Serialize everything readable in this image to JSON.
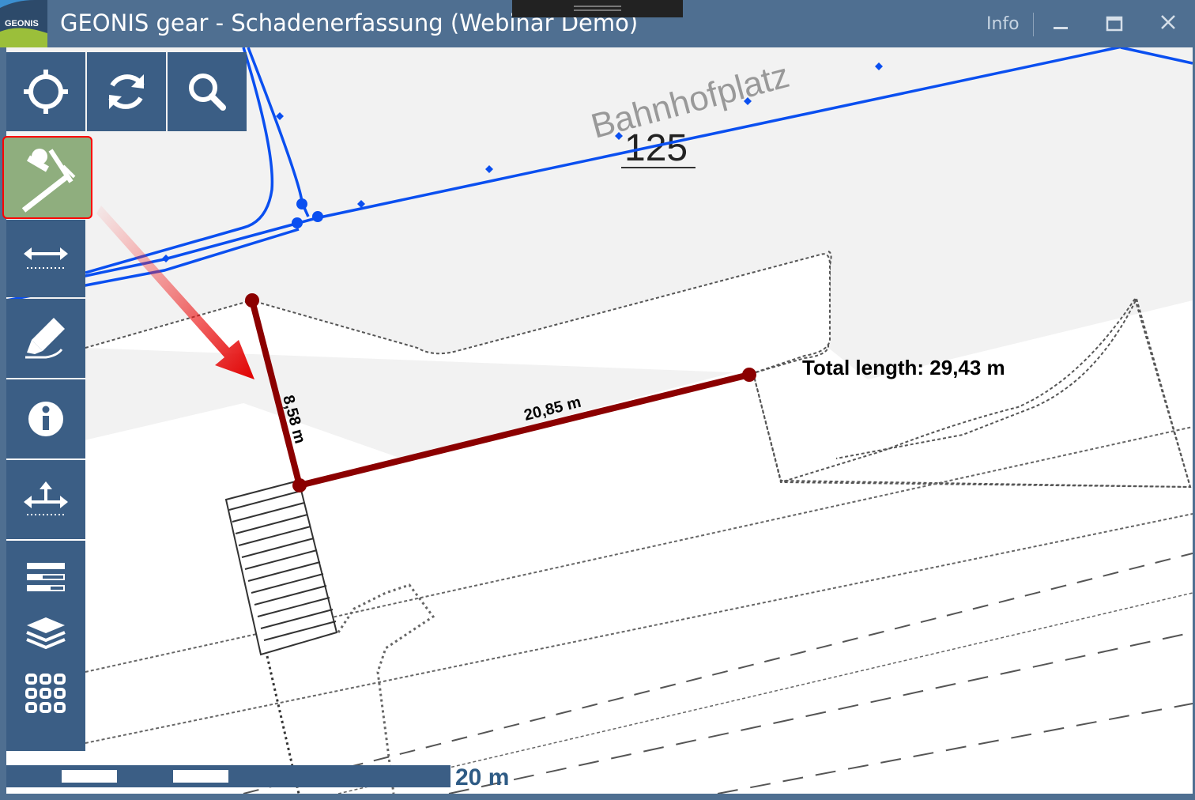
{
  "window": {
    "logo_text": "GEONIS",
    "title": "GEONIS gear - Schadenerfassung (Webinar Demo)",
    "info_label": "Info",
    "minimize_icon": "minimize-icon",
    "maximize_icon": "maximize-icon",
    "close_icon": "close-icon"
  },
  "map": {
    "place_name": "Bahnhofplatz",
    "parcel_number": "125",
    "measurement": {
      "segment_1_length": "8,58 m",
      "segment_2_length": "20,85 m",
      "total_label": "Total length: 29,43 m"
    },
    "line_color": "#8b0000",
    "network_color": "#0a4ff0"
  },
  "toolbar": {
    "top_row": [
      {
        "icon": "locate-icon"
      },
      {
        "icon": "refresh-icon"
      },
      {
        "icon": "search-icon"
      }
    ],
    "side": [
      {
        "icon": "measure-tool-icon",
        "active": true
      },
      {
        "icon": "measure-distance-icon"
      },
      {
        "icon": "highlighter-icon"
      },
      {
        "icon": "info-icon"
      },
      {
        "icon": "measure-height-icon"
      },
      {
        "icon": "legend-icon"
      },
      {
        "icon": "layers-icon"
      },
      {
        "icon": "apps-grid-icon"
      }
    ],
    "active_color": "#8fae7e",
    "highlight_color": "#ff0000"
  },
  "scale": {
    "label": "20 m"
  }
}
